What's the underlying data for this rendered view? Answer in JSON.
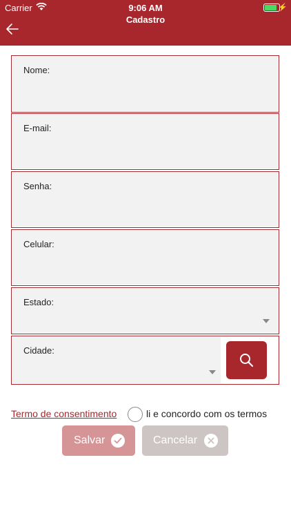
{
  "status_bar": {
    "carrier": "Carrier",
    "time": "9:06 AM",
    "battery_level": 0.85
  },
  "header": {
    "title": "Cadastro"
  },
  "form": {
    "nome": {
      "label": "Nome:",
      "value": ""
    },
    "email": {
      "label": "E-mail:",
      "value": ""
    },
    "senha": {
      "label": "Senha:",
      "value": ""
    },
    "celular": {
      "label": "Celular:",
      "value": ""
    },
    "estado": {
      "label": "Estado:",
      "selected": ""
    },
    "cidade": {
      "label": "Cidade:",
      "selected": ""
    }
  },
  "consent": {
    "link_text": "Termo de consentimento",
    "checkbox_label": "li e concordo com os termos",
    "checked": false
  },
  "buttons": {
    "save_label": "Salvar",
    "cancel_label": "Cancelar"
  },
  "colors": {
    "primary": "#a8272d",
    "save_disabled": "#d59496",
    "cancel_disabled": "#ccc5c3",
    "field_bg": "#f2f2f2"
  },
  "icons": {
    "back": "arrow-left-icon",
    "search": "magnifier-icon",
    "save": "check-circle-icon",
    "cancel": "close-circle-icon"
  }
}
